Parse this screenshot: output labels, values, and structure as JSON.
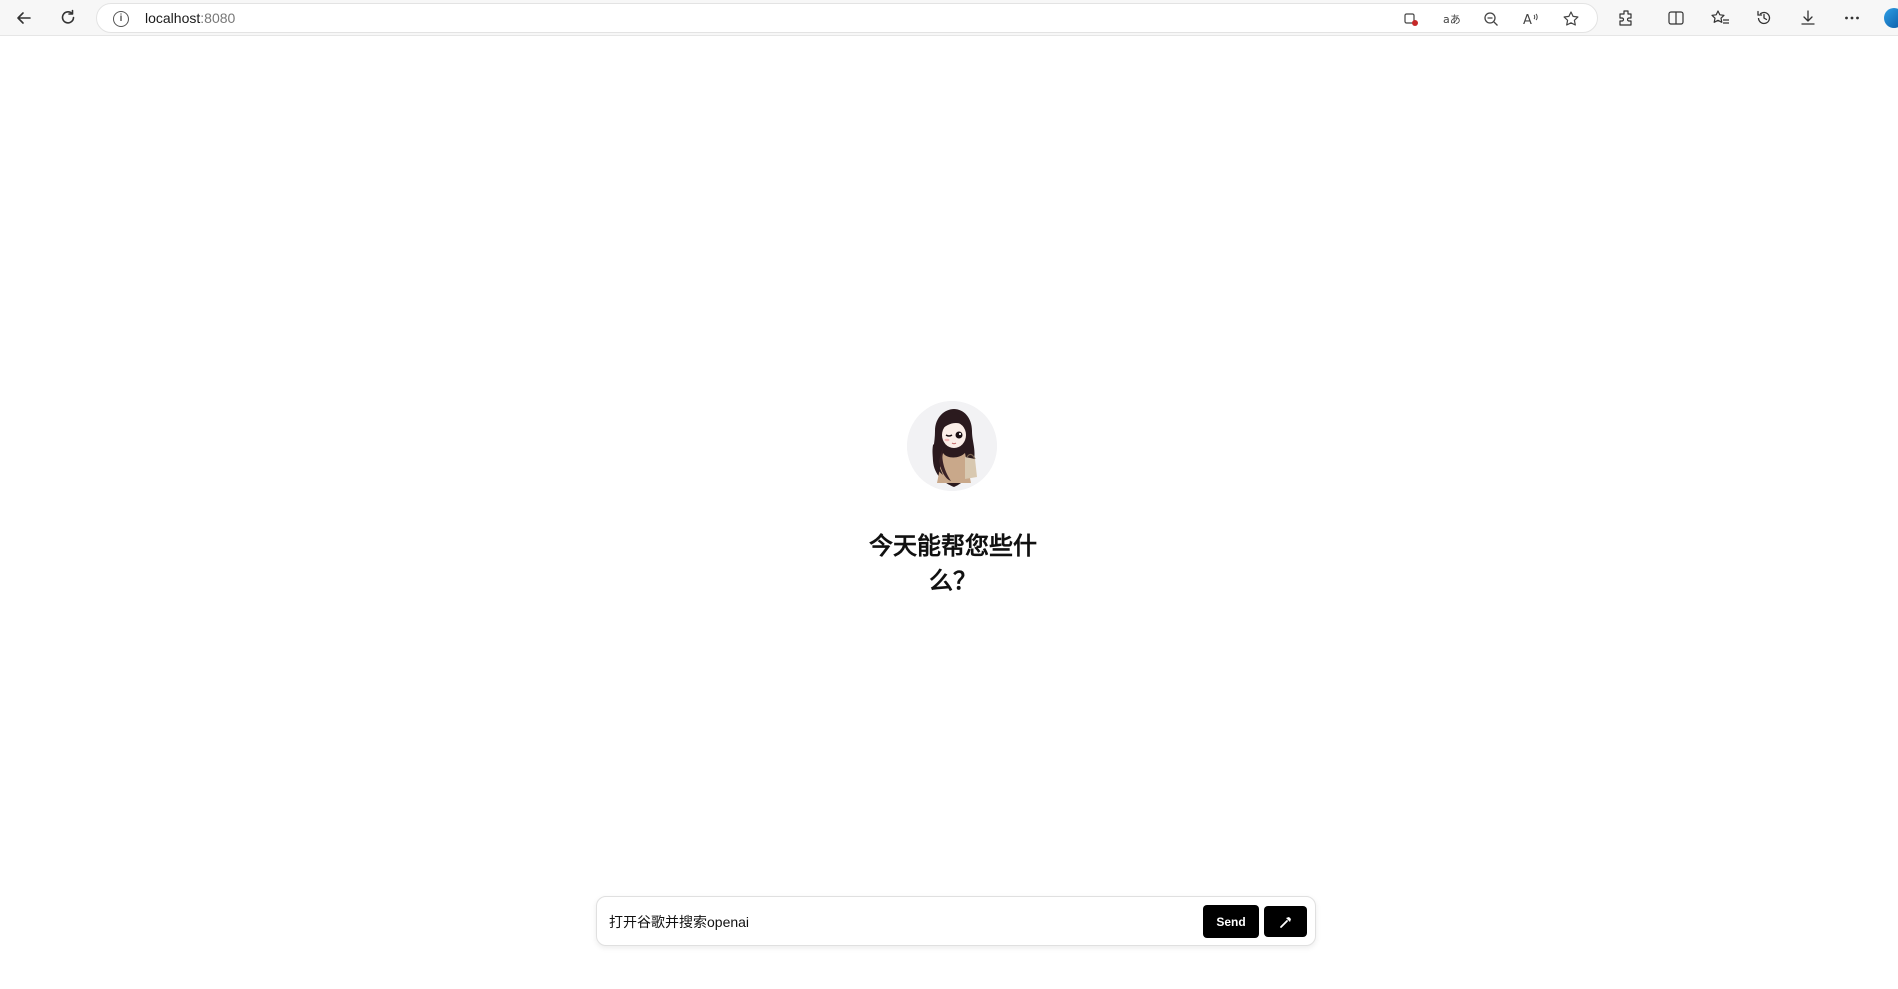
{
  "browser": {
    "url_host": "localhost",
    "url_port": ":8080"
  },
  "main": {
    "greeting": "今天能帮您些什么？"
  },
  "composer": {
    "input_value": "打开谷歌并搜索openai",
    "send_label": "Send",
    "tool_icon": "hammer-icon"
  },
  "colors": {
    "button_bg": "#000000",
    "button_text": "#ffffff"
  }
}
